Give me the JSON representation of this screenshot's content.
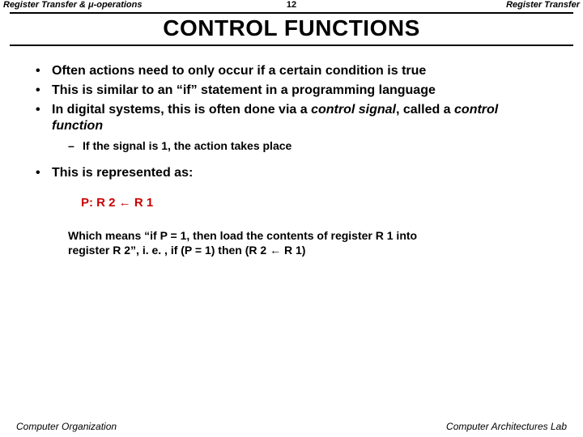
{
  "header": {
    "left": "Register Transfer & μ-operations",
    "page": "12",
    "right": "Register Transfer"
  },
  "title": "CONTROL FUNCTIONS",
  "bullets": {
    "b1": "Often actions need to only occur if a certain condition is true",
    "b2": "This is similar to an “if” statement in a programming language",
    "b3_pre": "In digital systems, this is often done via a ",
    "b3_sig": "control signal",
    "b3_mid": ", called a ",
    "b3_fun": "control function",
    "b3_sub": "If the signal is 1, the action takes place",
    "b4": "This is represented as:"
  },
  "notation": {
    "p": "P: R 2",
    "arrow": " ← ",
    "r1": "R 1"
  },
  "explain": {
    "line1": "Which means “if P = 1, then load the contents of register R 1 into",
    "line2_pre": "register R 2”, i. e. , if (P = 1)  then  (R 2 ",
    "line2_arrow": "←",
    "line2_post": " R 1)"
  },
  "footer": {
    "left": "Computer Organization",
    "right": "Computer Architectures Lab"
  }
}
